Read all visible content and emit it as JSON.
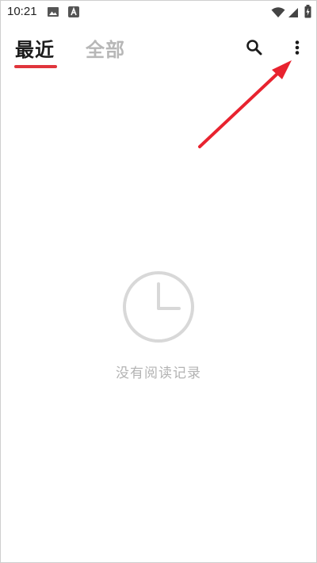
{
  "status_bar": {
    "time": "10:21",
    "icons": [
      "image-icon",
      "text-badge-icon",
      "wifi-icon",
      "signal-icon",
      "battery-icon"
    ]
  },
  "header": {
    "tabs": [
      {
        "label": "最近",
        "active": true
      },
      {
        "label": "全部",
        "active": false
      }
    ],
    "actions": [
      "search-icon",
      "more-vert-icon"
    ]
  },
  "empty_state": {
    "icon": "clock-icon",
    "message": "没有阅读记录"
  },
  "colors": {
    "accent": "#e0353c",
    "annotation_arrow": "#e8232f",
    "inactive_text": "#b7b7b7",
    "empty_text": "#b3b3b3"
  }
}
